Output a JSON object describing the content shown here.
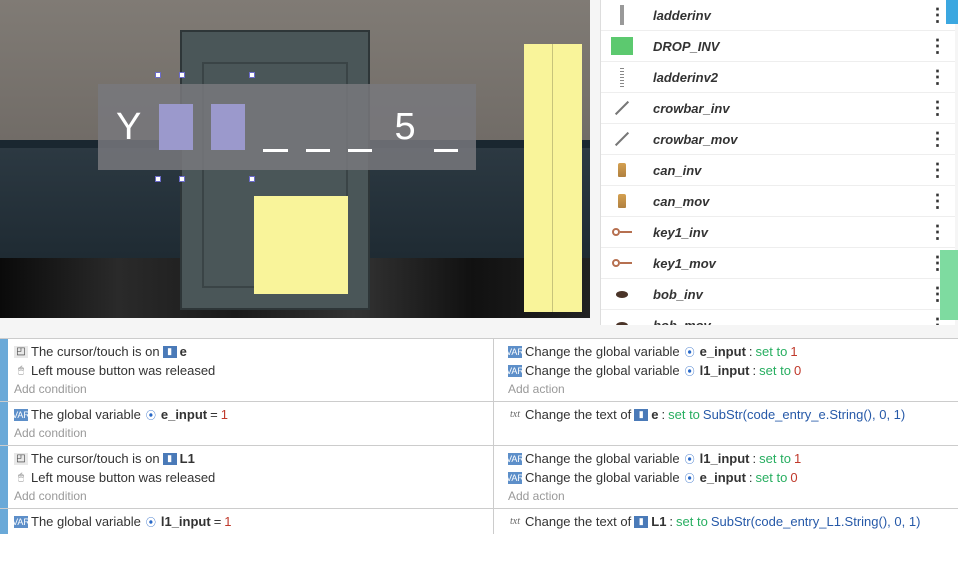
{
  "scene": {
    "overlay_letter": "Y",
    "overlay_number": "5"
  },
  "objects": [
    {
      "name": "ladderinv",
      "icon": "ladder"
    },
    {
      "name": "DROP_INV",
      "icon": "green"
    },
    {
      "name": "ladderinv2",
      "icon": "ladder2"
    },
    {
      "name": "crowbar_inv",
      "icon": "crowbar"
    },
    {
      "name": "crowbar_mov",
      "icon": "crowbar"
    },
    {
      "name": "can_inv",
      "icon": "can"
    },
    {
      "name": "can_mov",
      "icon": "can"
    },
    {
      "name": "key1_inv",
      "icon": "key"
    },
    {
      "name": "key1_mov",
      "icon": "key"
    },
    {
      "name": "bob_inv",
      "icon": "bob"
    },
    {
      "name": "bob_mov",
      "icon": "bob"
    }
  ],
  "events": [
    {
      "conditions": [
        {
          "icon": "cursor",
          "text_parts": [
            "The cursor/touch is on ",
            {
              "obj": "e"
            }
          ]
        },
        {
          "icon": "mouse",
          "text_parts": [
            "Left mouse button was released"
          ]
        }
      ],
      "actions": [
        {
          "icon": "varbox",
          "text_parts": [
            "Change the global variable ",
            {
              "var": "e_input"
            },
            ": ",
            {
              "green": "set to"
            },
            " ",
            {
              "red": "1"
            }
          ]
        },
        {
          "icon": "varbox",
          "text_parts": [
            "Change the global variable ",
            {
              "var": "l1_input"
            },
            ": ",
            {
              "green": "set to"
            },
            " ",
            {
              "red": "0"
            }
          ]
        }
      ],
      "add_condition": "Add condition",
      "add_action": "Add action"
    },
    {
      "conditions": [
        {
          "icon": "varbox",
          "text_parts": [
            "The global variable ",
            {
              "var": "e_input"
            },
            " = ",
            {
              "red": "1"
            }
          ]
        }
      ],
      "actions": [
        {
          "icon": "txt",
          "text_parts": [
            "Change the text of ",
            {
              "obj": "e"
            },
            ": ",
            {
              "green": "set to"
            },
            " ",
            {
              "blue": "SubStr(code_entry_e.String(), 0, 1)"
            }
          ]
        }
      ],
      "add_condition": "Add condition",
      "add_action": ""
    },
    {
      "conditions": [
        {
          "icon": "cursor",
          "text_parts": [
            "The cursor/touch is on ",
            {
              "obj": "L1"
            }
          ]
        },
        {
          "icon": "mouse",
          "text_parts": [
            "Left mouse button was released"
          ]
        }
      ],
      "actions": [
        {
          "icon": "varbox",
          "text_parts": [
            "Change the global variable ",
            {
              "var": "l1_input"
            },
            ": ",
            {
              "green": "set to"
            },
            " ",
            {
              "red": "1"
            }
          ]
        },
        {
          "icon": "varbox",
          "text_parts": [
            "Change the global variable ",
            {
              "var": "e_input"
            },
            ": ",
            {
              "green": "set to"
            },
            " ",
            {
              "red": "0"
            }
          ]
        }
      ],
      "add_condition": "Add condition",
      "add_action": "Add action"
    },
    {
      "conditions": [
        {
          "icon": "varbox",
          "text_parts": [
            "The global variable ",
            {
              "var": "l1_input"
            },
            " = ",
            {
              "red": "1"
            }
          ]
        }
      ],
      "actions": [
        {
          "icon": "txt",
          "text_parts": [
            "Change the text of ",
            {
              "obj": "L1"
            },
            ": ",
            {
              "green": "set to"
            },
            " ",
            {
              "blue": "SubStr(code_entry_L1.String(), 0, 1)"
            }
          ]
        }
      ],
      "add_condition": "",
      "add_action": ""
    }
  ]
}
